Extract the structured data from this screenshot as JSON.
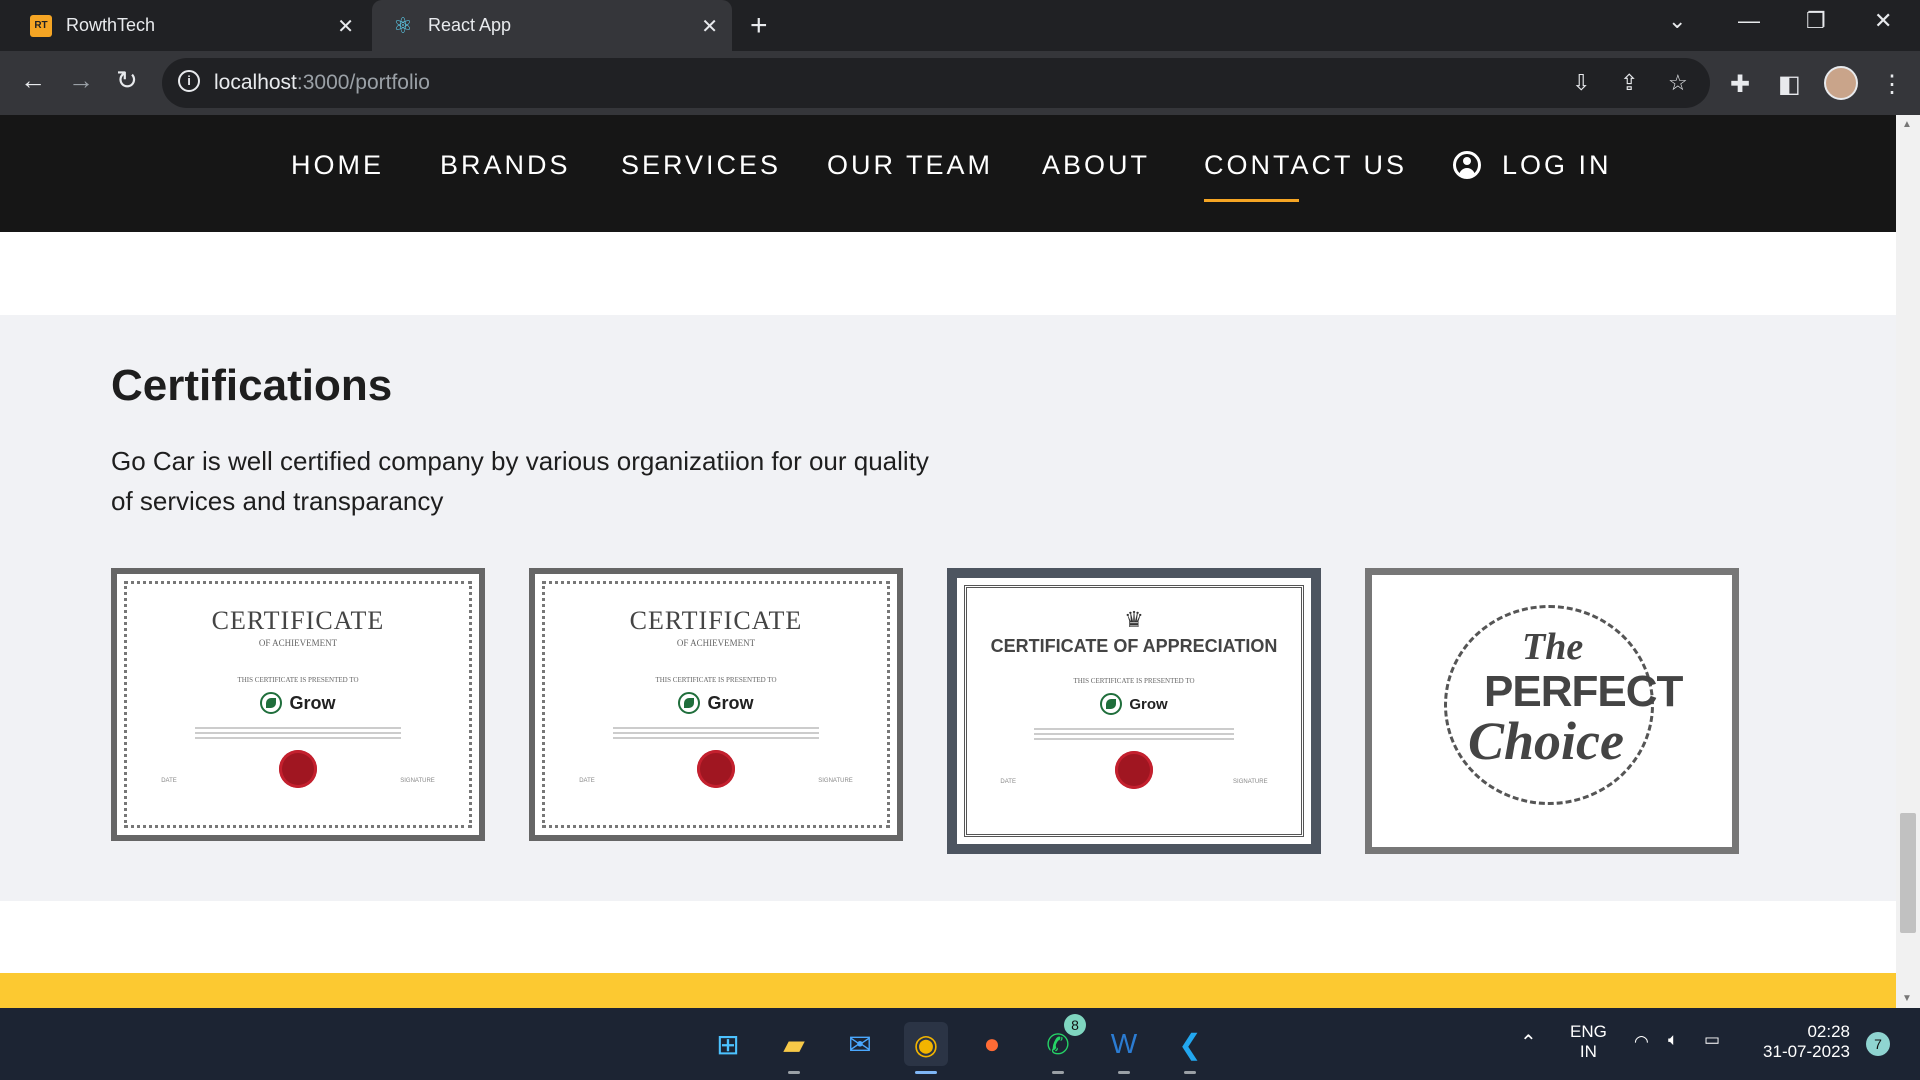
{
  "browser": {
    "tabs": [
      {
        "title": "RowthTech",
        "icon": "rt-favicon"
      },
      {
        "title": "React App",
        "icon": "react-favicon"
      }
    ],
    "url_host": "localhost",
    "url_path": ":3000/portfolio"
  },
  "nav": {
    "items": [
      "HOME",
      "BRANDS",
      "SERVICES",
      "OUR TEAM",
      "ABOUT",
      "CONTACT US"
    ],
    "login": "LOG IN",
    "active": "CONTACT US",
    "accent": "#f5a524"
  },
  "certifications": {
    "title": "Certifications",
    "description": "Go Car is well certified company by various organizatiion for our quality of services and transparancy",
    "cards": [
      {
        "heading": "CERTIFICATE",
        "sub": "OF ACHIEVEMENT",
        "presented": "THIS CERTIFICATE IS PRESENTED TO",
        "brand": "Grow",
        "date": "DATE",
        "signature": "SIGNATURE"
      },
      {
        "heading": "CERTIFICATE",
        "sub": "OF ACHIEVEMENT",
        "presented": "THIS CERTIFICATE IS PRESENTED TO",
        "brand": "Grow",
        "date": "DATE",
        "signature": "SIGNATURE"
      },
      {
        "heading": "CERTIFICATE OF APPRECIATION",
        "presented": "THIS CERTIFICATE IS PRESENTED TO",
        "brand": "Grow",
        "date": "DATE",
        "signature": "SIGNATURE"
      },
      {
        "the": "The",
        "perfect": "PERFECT",
        "choice": "Choice"
      }
    ]
  },
  "footer_band_color": "#fcc931",
  "taskbar": {
    "lang_top": "ENG",
    "lang_bottom": "IN",
    "time": "02:28",
    "date": "31-07-2023",
    "whatsapp_badge": "8",
    "notifications": "7"
  }
}
